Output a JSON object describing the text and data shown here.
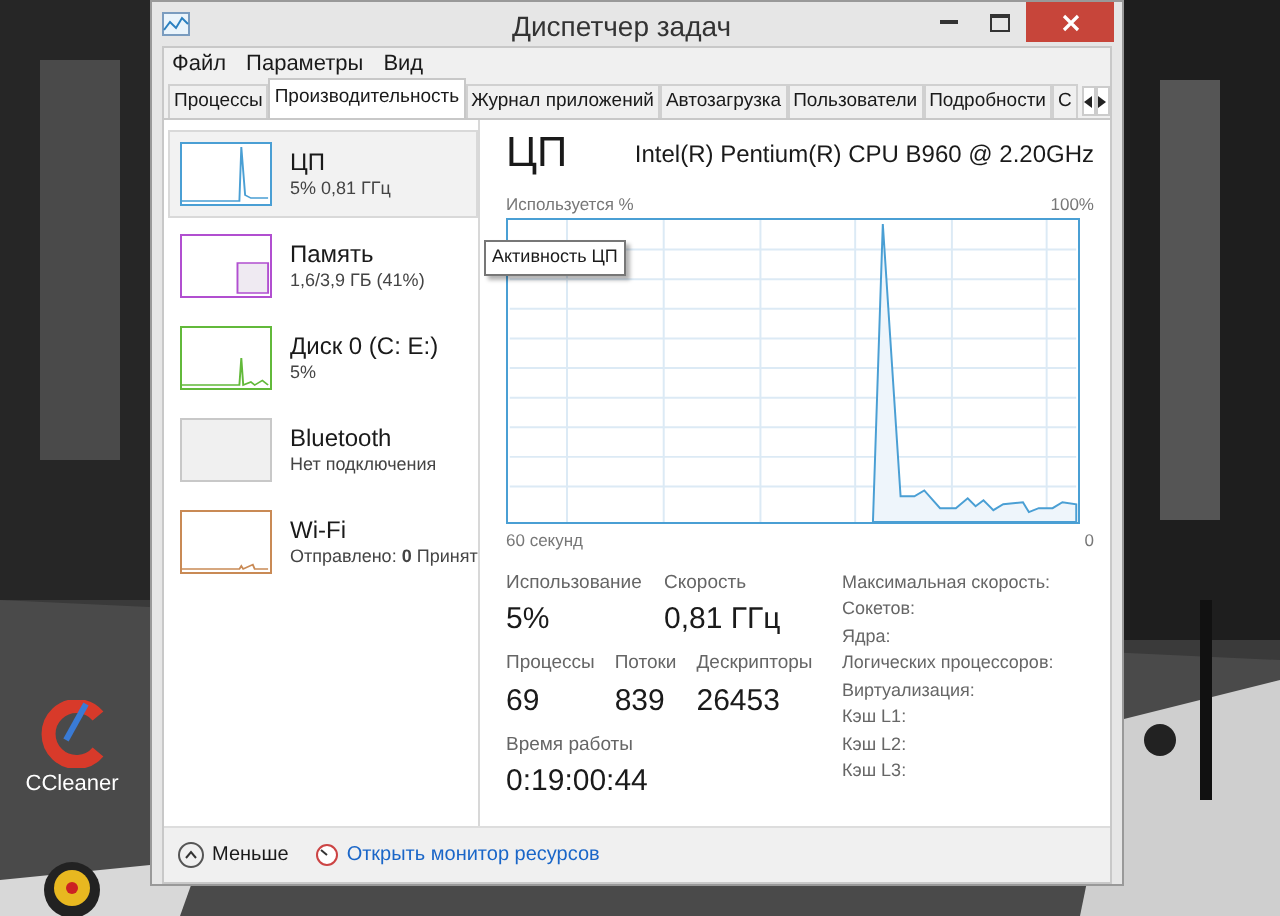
{
  "desktop_icons": [
    {
      "kind": "broom",
      "label": "CCleaner"
    },
    {
      "kind": "webcam"
    }
  ],
  "window": {
    "title": "Диспетчер задач"
  },
  "menu": [
    "Файл",
    "Параметры",
    "Вид"
  ],
  "tabs": [
    {
      "label": "Процессы",
      "selected": false
    },
    {
      "label": "Производительность",
      "selected": true
    },
    {
      "label": "Журнал приложений",
      "selected": false
    },
    {
      "label": "Автозагрузка",
      "selected": false
    },
    {
      "label": "Пользователи",
      "selected": false
    },
    {
      "label": "Подробности",
      "selected": false
    },
    {
      "label": "С",
      "selected": false
    }
  ],
  "sidebar": {
    "items": [
      {
        "kind": "cpu",
        "title": "ЦП",
        "subtitle": "5% 0,81 ГГц",
        "color": "#4a9fd4",
        "selected": true
      },
      {
        "kind": "memory",
        "title": "Память",
        "subtitle": "1,6/3,9 ГБ (41%)",
        "color": "#b14fd0",
        "selected": false
      },
      {
        "kind": "disk",
        "title": "Диск 0 (C: E:)",
        "subtitle": "5%",
        "color": "#62b93a",
        "selected": false
      },
      {
        "kind": "empty",
        "title": "Bluetooth",
        "subtitle": "Нет подключения",
        "color": "#c8c8c8",
        "selected": false
      },
      {
        "kind": "network",
        "title": "Wi-Fi",
        "subtitle": "Отправлено: **0** Принят",
        "color": "#c98a55",
        "selected": false
      }
    ]
  },
  "tooltip": "Активность ЦП",
  "detail": {
    "title": "ЦП",
    "model": "Intel(R) Pentium(R) CPU B960 @ 2.20GHz",
    "graph": {
      "ylabel": "Используется %",
      "ymax": "100%",
      "xleft": "60 секунд",
      "xright": "0"
    },
    "stats": [
      {
        "label": "Использование",
        "value": "5%"
      },
      {
        "label": "Скорость",
        "value": "0,81 ГГц"
      }
    ],
    "counts": [
      {
        "label": "Процессы",
        "value": "69"
      },
      {
        "label": "Потоки",
        "value": "839"
      },
      {
        "label": "Дескрипторы",
        "value": "26453"
      }
    ],
    "uptime": {
      "label": "Время работы",
      "value": "0:19:00:44"
    },
    "specs": [
      "Максимальная скорость:",
      "Сокетов:",
      "Ядра:",
      "Логических процессоров:",
      "Виртуализация:",
      "Кэш L1:",
      "Кэш L2:",
      "Кэш L3:"
    ]
  },
  "footer": {
    "less": "Меньше",
    "link": "Открыть монитор ресурсов"
  }
}
